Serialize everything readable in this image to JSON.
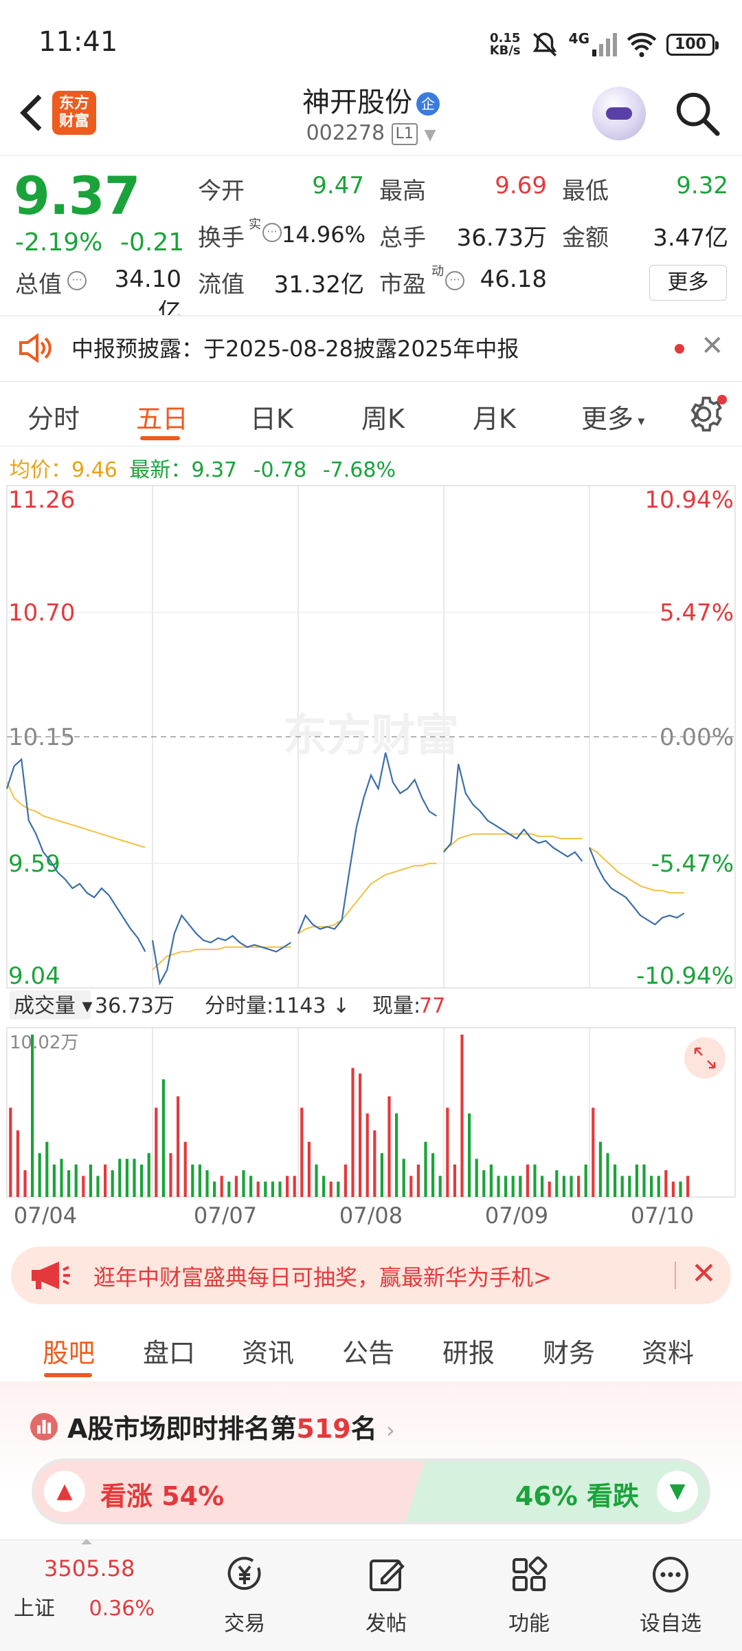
{
  "status_bar": {
    "time": "11:41",
    "net_speed_value": "0.15",
    "net_speed_unit": "KB/s",
    "network": "4G",
    "battery": "100"
  },
  "header": {
    "logo_text": "东方\n财富",
    "stock_name": "神开股份",
    "badge": "企",
    "stock_code": "002278",
    "level": "L1"
  },
  "quote": {
    "price": "9.37",
    "change_pct": "-2.19%",
    "change": "-0.21",
    "open_label": "今开",
    "open": "9.47",
    "high_label": "最高",
    "high": "9.69",
    "low_label": "最低",
    "low": "9.32",
    "turnover_label": "换手",
    "turnover_sup": "实",
    "turnover": "14.96%",
    "volume_label": "总手",
    "volume": "36.73万",
    "amount_label": "金额",
    "amount": "3.47亿",
    "mktcap_label": "总值",
    "mktcap": "34.10亿",
    "float_label": "流值",
    "float": "31.32亿",
    "pe_label": "市盈",
    "pe_sup": "动",
    "pe": "46.18",
    "more": "更多"
  },
  "notice": {
    "text": "中报预披露：于2025-08-28披露2025年中报"
  },
  "chart_tabs": [
    "分时",
    "五日",
    "日K",
    "周K",
    "月K",
    "更多"
  ],
  "price_info": {
    "avg_label": "均价：",
    "avg": "9.46",
    "latest_label": "最新：",
    "latest": "9.37",
    "chg": "-0.78",
    "chg_pct": "-7.68%"
  },
  "chart_data": {
    "type": "line",
    "watermark": "东方财富",
    "x_labels": [
      "07/04",
      "07/07",
      "07/08",
      "07/09",
      "07/10"
    ],
    "y_left_ticks": [
      "11.26",
      "10.70",
      "10.15",
      "9.59",
      "9.04"
    ],
    "y_right_ticks": [
      "10.94%",
      "5.47%",
      "0.00%",
      "-5.47%",
      "-10.94%"
    ],
    "ylim": [
      9.04,
      11.26
    ],
    "prev_close": 10.15,
    "volume_label": "成交量",
    "volume_total": "36.73万",
    "min_volume_label": "分时量:1143",
    "current_volume_label": "现量:",
    "current_volume": "77",
    "volume_max": "10.02万",
    "colors": {
      "price": "#3a6ea8",
      "avg": "#f0c040",
      "up": "#e4393c",
      "down": "#1aa33a"
    },
    "days": [
      {
        "date": "07/04",
        "price": [
          9.92,
          10.02,
          10.05,
          9.78,
          9.72,
          9.64,
          9.6,
          9.55,
          9.52,
          9.48,
          9.5,
          9.46,
          9.44,
          9.48,
          9.45,
          9.4,
          9.35,
          9.3,
          9.26,
          9.2
        ],
        "avg": [
          9.95,
          9.88,
          9.85,
          9.83,
          9.82,
          9.8,
          9.79,
          9.78,
          9.77,
          9.76,
          9.75,
          9.74,
          9.73,
          9.72,
          9.71,
          9.7,
          9.69,
          9.68,
          9.67,
          9.66
        ]
      },
      {
        "date": "07/07",
        "price": [
          9.25,
          9.06,
          9.12,
          9.28,
          9.36,
          9.32,
          9.28,
          9.25,
          9.24,
          9.26,
          9.25,
          9.27,
          9.24,
          9.22,
          9.23,
          9.22,
          9.21,
          9.2,
          9.22,
          9.24
        ],
        "avg": [
          9.12,
          9.15,
          9.18,
          9.19,
          9.2,
          9.2,
          9.21,
          9.21,
          9.21,
          9.21,
          9.22,
          9.22,
          9.22,
          9.22,
          9.22,
          9.22,
          9.22,
          9.22,
          9.22,
          9.22
        ]
      },
      {
        "date": "07/08",
        "price": [
          9.28,
          9.36,
          9.32,
          9.3,
          9.31,
          9.3,
          9.34,
          9.55,
          9.75,
          9.88,
          9.98,
          9.92,
          10.08,
          9.95,
          9.9,
          9.92,
          9.96,
          9.88,
          9.82,
          9.8
        ],
        "avg": [
          9.28,
          9.3,
          9.31,
          9.31,
          9.31,
          9.32,
          9.34,
          9.38,
          9.42,
          9.46,
          9.5,
          9.52,
          9.54,
          9.55,
          9.56,
          9.57,
          9.58,
          9.58,
          9.59,
          9.59
        ]
      },
      {
        "date": "07/09",
        "price": [
          9.64,
          9.68,
          10.03,
          9.9,
          9.85,
          9.82,
          9.78,
          9.76,
          9.74,
          9.72,
          9.7,
          9.74,
          9.7,
          9.68,
          9.69,
          9.66,
          9.64,
          9.62,
          9.64,
          9.6
        ],
        "avg": [
          9.65,
          9.67,
          9.7,
          9.71,
          9.72,
          9.72,
          9.72,
          9.72,
          9.72,
          9.72,
          9.72,
          9.72,
          9.72,
          9.71,
          9.71,
          9.71,
          9.7,
          9.7,
          9.7,
          9.7
        ]
      },
      {
        "date": "07/10",
        "price": [
          9.66,
          9.58,
          9.52,
          9.48,
          9.46,
          9.44,
          9.4,
          9.36,
          9.34,
          9.32,
          9.35,
          9.36,
          9.35,
          9.37
        ],
        "avg": [
          9.66,
          9.64,
          9.61,
          9.58,
          9.55,
          9.53,
          9.51,
          9.49,
          9.48,
          9.47,
          9.47,
          9.46,
          9.46,
          9.46
        ]
      }
    ]
  },
  "banner": {
    "text": "逛年中财富盛典每日可抽奖，赢最新华为手机>"
  },
  "info_tabs": [
    "股吧",
    "盘口",
    "资讯",
    "公告",
    "研报",
    "财务",
    "资料"
  ],
  "rank": {
    "prefix": "A股市场即时排名第",
    "number": "519",
    "suffix": "名",
    "up_label": "看涨 54%",
    "down_label": "46% 看跌",
    "up_fraction": 0.54
  },
  "bottom_nav": {
    "index_value": "3505.58",
    "index_name": "上证",
    "index_pct": "0.36%",
    "items": [
      "交易",
      "发帖",
      "功能",
      "设自选"
    ]
  }
}
